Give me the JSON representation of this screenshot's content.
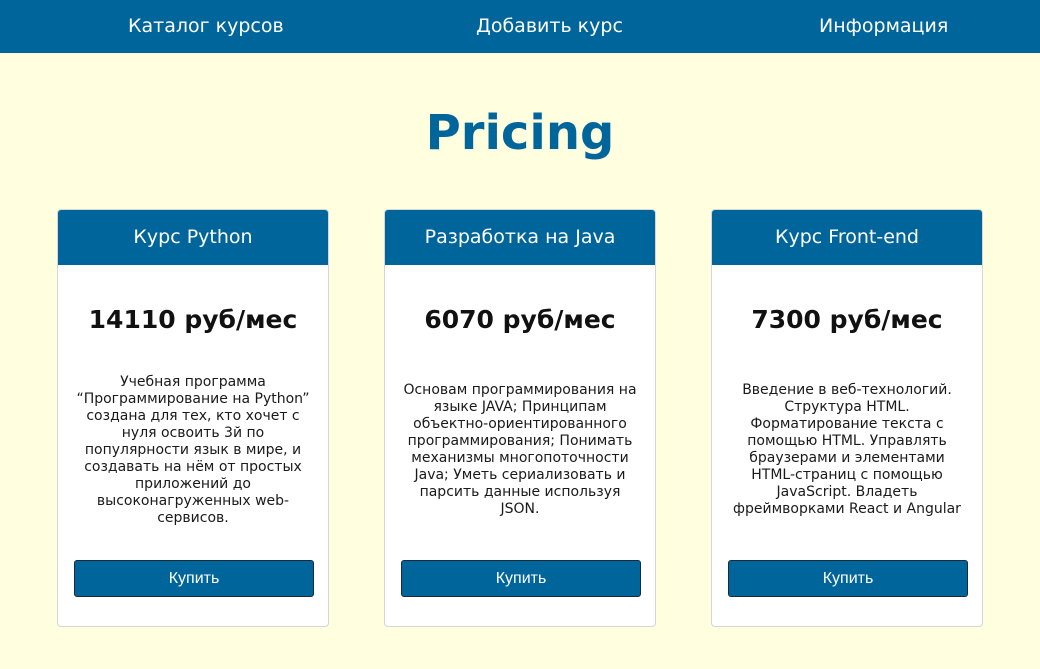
{
  "nav": {
    "items": [
      {
        "label": "Каталог курсов"
      },
      {
        "label": "Добавить курс"
      },
      {
        "label": "Информация"
      }
    ]
  },
  "page": {
    "title": "Pricing"
  },
  "cards": [
    {
      "title": "Курс Python",
      "price": "14110 руб/мес",
      "description": "Учебная программа “Программирование на Python” создана для тех, кто хочет с нуля освоить 3й по популярности язык в мире, и создавать на нём от простых приложений до высоконагруженных web-сервисов.",
      "button_label": "Купить"
    },
    {
      "title": "Разработка на Java",
      "price": "6070 руб/мес",
      "description": "Основам программирования на языке JAVA; Принципам объектно-ориентированного программирования; Понимать механизмы многопоточности Java; Уметь сериализовать и парсить данные используя JSON.",
      "button_label": "Купить"
    },
    {
      "title": "Курс Front-end",
      "price": "7300 руб/мес",
      "description": "Введение в веб-технологий. Структура HTML. Форматирование текста с помощью HTML. Управлять браузерами и элементами HTML-страниц с помощью JavaScript. Владеть фреймворками React и Angular",
      "button_label": "Купить"
    }
  ],
  "colors": {
    "primary": "#00659b",
    "background": "#ffffe0",
    "card_background": "#ffffff"
  }
}
